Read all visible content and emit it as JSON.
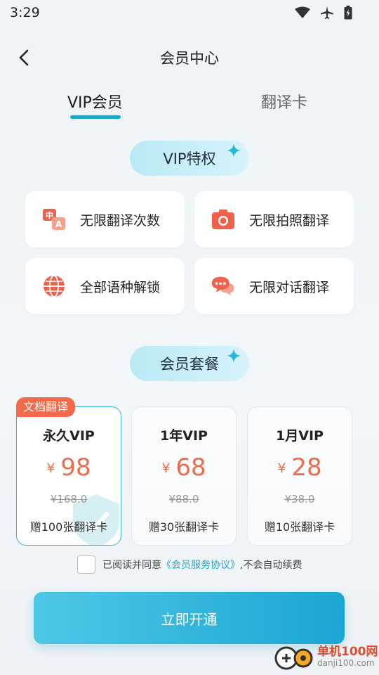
{
  "status": {
    "time": "3:29"
  },
  "nav": {
    "title": "会员中心"
  },
  "tabs": {
    "vip": "VIP会员",
    "card": "翻译卡"
  },
  "sections": {
    "vip_privileges": "VIP特权",
    "packages": "会员套餐"
  },
  "features": [
    {
      "label": "无限翻译次数",
      "icon": "translate-icon"
    },
    {
      "label": "无限拍照翻译",
      "icon": "camera-icon"
    },
    {
      "label": "全部语种解锁",
      "icon": "globe-icon"
    },
    {
      "label": "无限对话翻译",
      "icon": "chat-icon"
    }
  ],
  "badge": "文档翻译",
  "plans": [
    {
      "name": "永久VIP",
      "currency": "¥",
      "price": "98",
      "original": "¥168.0",
      "gift": "赠100张翻译卡",
      "selected": true
    },
    {
      "name": "1年VIP",
      "currency": "¥",
      "price": "68",
      "original": "¥88.0",
      "gift": "赠30张翻译卡",
      "selected": false
    },
    {
      "name": "1月VIP",
      "currency": "¥",
      "price": "28",
      "original": "¥38.0",
      "gift": "赠10张翻译卡",
      "selected": false
    }
  ],
  "agreement": {
    "prefix": "已阅读并同意",
    "link": "《会员服务协议》",
    "suffix": ",不会自动续费"
  },
  "cta": "立即开通",
  "watermark": {
    "title": "单机100网",
    "url": "danji100.com"
  },
  "colors": {
    "accent": "#1ea6c9",
    "price": "#f06b4a",
    "badge": "#f4694a",
    "icon": "#f0604a"
  }
}
